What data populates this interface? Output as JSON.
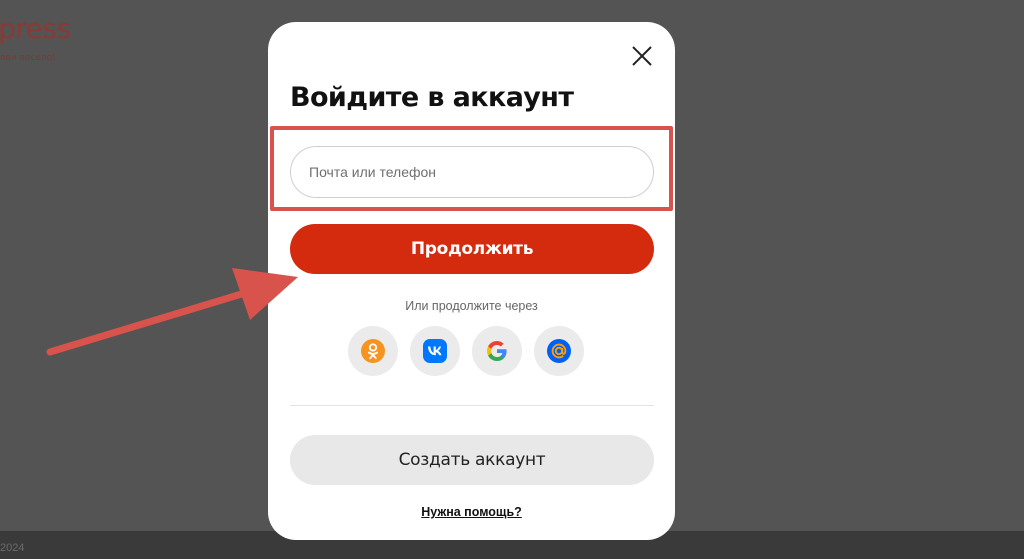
{
  "background": {
    "logo_text": "press",
    "tagline": "ови весело!",
    "footer_year": "2024"
  },
  "modal": {
    "title": "Войдите в аккаунт",
    "login_field": {
      "placeholder": "Почта или телефон",
      "value": ""
    },
    "continue_label": "Продолжить",
    "or_continue_with": "Или продолжите через",
    "social_buttons": [
      {
        "name": "odnoklassniki",
        "icon": "odnoklassniki-icon",
        "color": "#f7931e"
      },
      {
        "name": "vk",
        "icon": "vk-icon",
        "color": "#0077ff"
      },
      {
        "name": "google",
        "icon": "google-icon",
        "color": "#4285f4"
      },
      {
        "name": "mailru",
        "icon": "mailru-icon",
        "color": "#005ff9"
      }
    ],
    "create_account_label": "Создать аккаунт",
    "help_label": "Нужна помощь?"
  },
  "colors": {
    "accent": "#d42a0e",
    "annotation": "#d9534d",
    "overlay": "#545454"
  }
}
